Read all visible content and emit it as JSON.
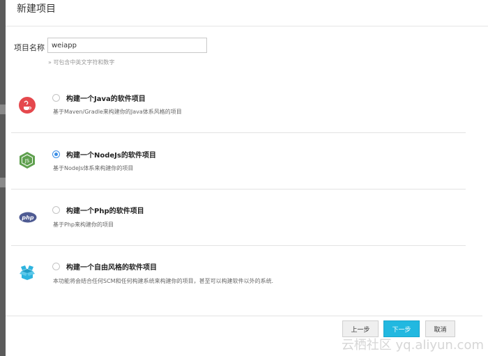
{
  "dialog": {
    "title": "新建项目",
    "name_label": "项目名称",
    "name_value": "weiapp",
    "name_hint": "» 可包含中英文字符和数字"
  },
  "options": [
    {
      "title": "构建一个Java的软件项目",
      "desc": "基于Maven/Gradle来构建你的Java体系风格的项目",
      "icon": "java-icon",
      "selected": false
    },
    {
      "title": "构建一个NodeJs的软件项目",
      "desc": "基于NodeJs体系来构建你的项目",
      "icon": "nodejs-icon",
      "selected": true
    },
    {
      "title": "构建一个Php的软件项目",
      "desc": "基于Php来构建你的项目",
      "icon": "php-icon",
      "selected": false
    },
    {
      "title": "构建一个自由风格的软件项目",
      "desc": "本功能将会结合任何SCM和任何构建系统来构建你的项目，甚至可以构建软件以外的系统.",
      "icon": "box-icon",
      "selected": false
    }
  ],
  "buttons": {
    "prev": "上一步",
    "next": "下一步",
    "cancel": "取消"
  },
  "watermark": "云栖社区 yq.aliyun.com",
  "colors": {
    "accent": "#22b8e0",
    "radio_selected": "#3a8ee6",
    "java": "#e5484d",
    "nodejs": "#5fa04e",
    "php": "#4f5b93",
    "box": "#2eb4df"
  }
}
